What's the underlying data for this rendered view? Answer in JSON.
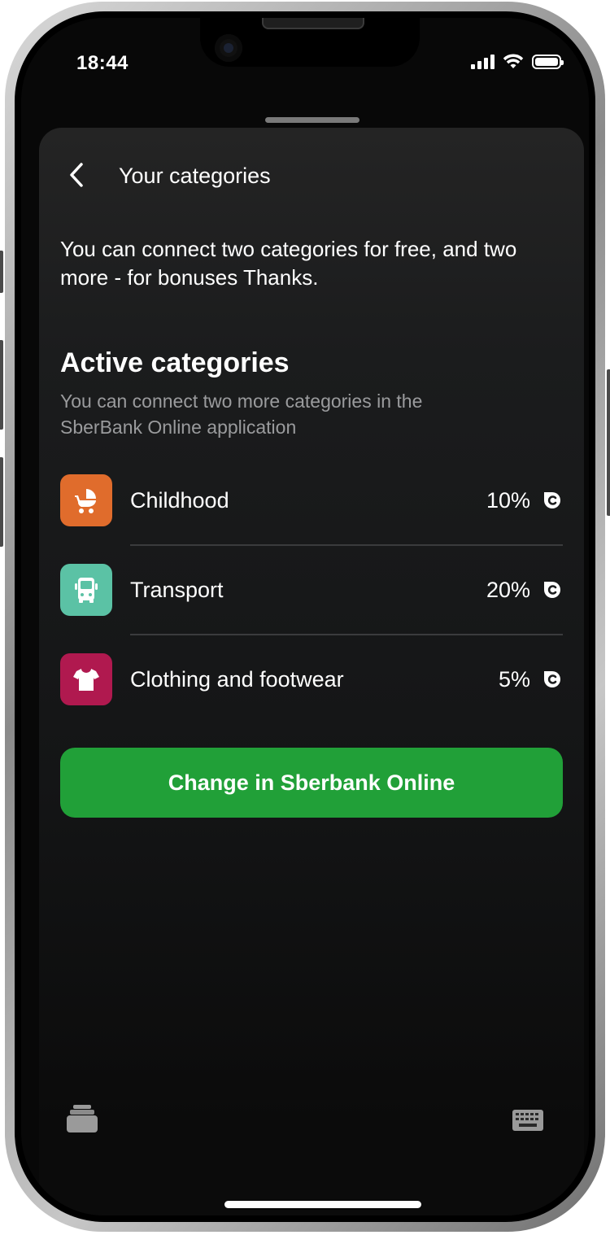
{
  "status_bar": {
    "time": "18:44",
    "icons": [
      "signal-icon",
      "wifi-icon",
      "battery-icon"
    ]
  },
  "header": {
    "back_icon": "chevron-left-icon",
    "title": "Your categories"
  },
  "intro_text": "You can connect two categories for free, and two more - for bonuses Thanks.",
  "section": {
    "title": "Active categories",
    "subtitle": "You can connect two more categories in the SberBank Online application"
  },
  "categories": [
    {
      "name": "Childhood",
      "percent": "10%",
      "icon": "stroller-icon",
      "color": "#e06c2c"
    },
    {
      "name": "Transport",
      "percent": "20%",
      "icon": "bus-icon",
      "color": "#5bc2a5"
    },
    {
      "name": "Clothing and footwear",
      "percent": "5%",
      "icon": "tshirt-icon",
      "color": "#b0194f"
    }
  ],
  "bonus_icon": "sberspasibo-bonus-icon",
  "cta": {
    "label": "Change in Sberbank Online",
    "color": "#21a038"
  },
  "bottom_bar": {
    "left_icon": "keyboard-dismiss-icon",
    "right_icon": "keyboard-icon"
  }
}
